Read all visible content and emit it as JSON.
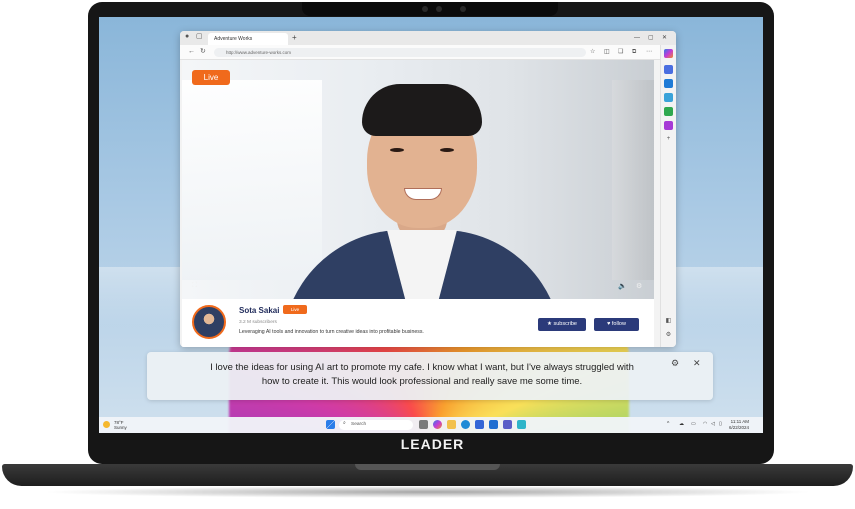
{
  "browser": {
    "tab_title": "Adventure Works",
    "address": "http://www.adventure-works.com"
  },
  "stream": {
    "live_label": "Live",
    "channel_name": "Sota Sakai",
    "subscribers": "3.2 M subscribers",
    "description": "Leveraging AI tools and innovation to turn creative ideas into profitable business.",
    "subscribe_label": "subscribe",
    "follow_label": "follow"
  },
  "caption": {
    "text": "I love the ideas for using AI art to promote my cafe. I know what I want, but I've always struggled with how to create it. This would look professional and really save me some time."
  },
  "taskbar": {
    "weather_temp": "78°F",
    "weather_desc": "Sunny",
    "search_placeholder": "Search",
    "time": "11:11 AM",
    "date": "6/22/2024"
  },
  "laptop": {
    "brand": "LEADER"
  },
  "colors": {
    "live_orange": "#f06a1c",
    "button_navy": "#2b3a7a"
  }
}
